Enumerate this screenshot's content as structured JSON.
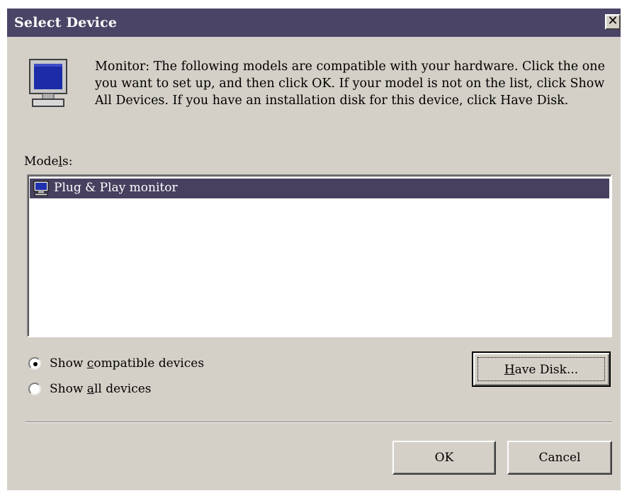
{
  "window": {
    "title": "Select Device",
    "close_glyph": "✕"
  },
  "intro": {
    "icon": "monitor-icon",
    "text": "Monitor: The following models are compatible with your hardware. Click the one you want to set up, and then click OK. If your model is not on the list, click Show All Devices. If you have an installation disk for this device, click Have Disk."
  },
  "models": {
    "label_pre": "Mode",
    "label_accel": "l",
    "label_post": "s:",
    "items": [
      {
        "label": "Plug & Play monitor",
        "icon": "monitor-icon",
        "selected": true
      }
    ]
  },
  "options": {
    "compatible": {
      "pre": "Show ",
      "accel": "c",
      "post": "ompatible devices",
      "checked": true
    },
    "all": {
      "pre": "Show ",
      "accel": "a",
      "post": "ll devices",
      "checked": false
    }
  },
  "buttons": {
    "have_disk": {
      "accel": "H",
      "rest": "ave Disk..."
    },
    "ok": "OK",
    "cancel": "Cancel"
  },
  "colors": {
    "titlebar": "#4a4566",
    "face": "#d4d0c8",
    "selection": "#47405f"
  }
}
